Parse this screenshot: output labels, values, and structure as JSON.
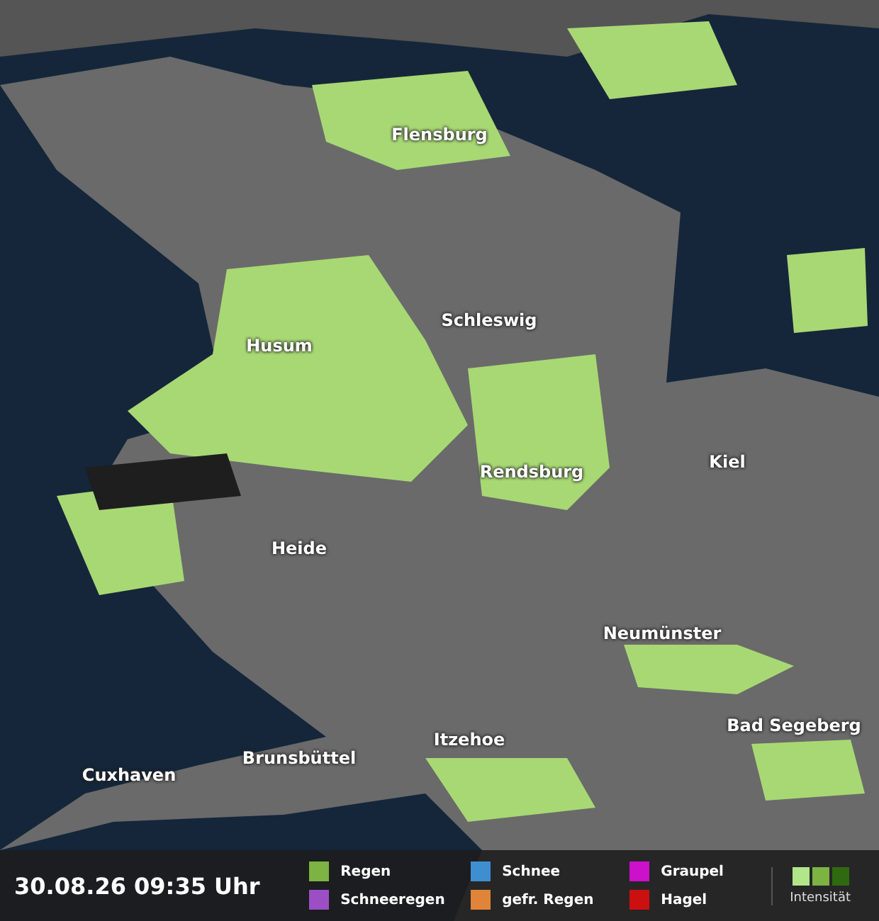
{
  "cities": [
    {
      "name": "Flensburg"
    },
    {
      "name": "Schleswig"
    },
    {
      "name": "Husum"
    },
    {
      "name": "Kiel"
    },
    {
      "name": "Rendsburg"
    },
    {
      "name": "Heide"
    },
    {
      "name": "Neumünster"
    },
    {
      "name": "Bad Segeberg"
    },
    {
      "name": "Itzehoe"
    },
    {
      "name": "Brunsbüttel"
    },
    {
      "name": "Cuxhaven"
    }
  ],
  "timestamp": "30.08.26 09:35 Uhr",
  "legend": [
    {
      "label": "Regen",
      "color": "#7cb342"
    },
    {
      "label": "Schneeregen",
      "color": "#9c4fc4"
    },
    {
      "label": "Schnee",
      "color": "#3f8fd0"
    },
    {
      "label": "gefr. Regen",
      "color": "#e0843a"
    },
    {
      "label": "Graupel",
      "color": "#cc10cc"
    },
    {
      "label": "Hagel",
      "color": "#cc1010"
    }
  ],
  "intensity": {
    "label": "Intensität"
  }
}
